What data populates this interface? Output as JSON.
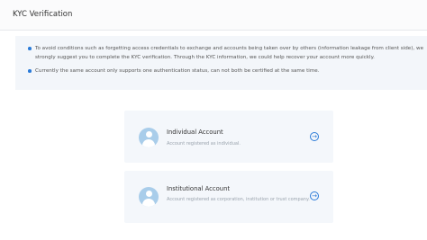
{
  "header": {
    "title": "KYC Verification"
  },
  "notice": {
    "items": [
      {
        "line1": "To avoid conditions such as forgetting access credentials to exchange and accounts being taken over by others (information leakage from client side), we",
        "line2": "strongly suggest you to complete the KYC verification. Through the KYC information, we could help recover your account more quickly."
      },
      {
        "line1": "Currently the same account only supports one authentication status, can not both be certified at the same time."
      }
    ]
  },
  "accounts": [
    {
      "title": "Individual Account",
      "desc": "Account registered as individual."
    },
    {
      "title": "Institutional Account",
      "desc": "Account registered as corporation, institution or trust company."
    }
  ],
  "icons": {
    "avatar": "user-avatar-icon",
    "arrow": "arrow-right-circle-icon"
  },
  "colors": {
    "accent": "#2b7bd8",
    "avatar_bg": "#a9cdea",
    "card_bg": "#f4f7fb",
    "notice_bg": "#f3f6fa"
  }
}
